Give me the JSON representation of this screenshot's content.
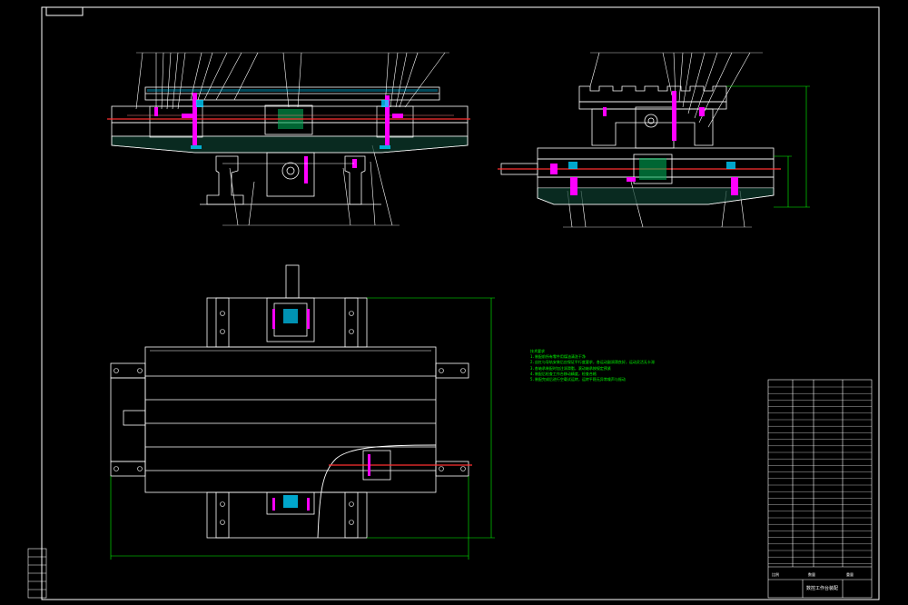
{
  "title_block": {
    "drawing_title": "数控工作台装配",
    "sheet_marks": [
      "比例",
      "数量",
      "重量"
    ]
  },
  "notes": [
    "技术要求",
    "1.装配前所有零件用煤油清洗干净",
    "2.丝杠与导轨安装后应保证平行度要求，各运动副润滑良好，运动灵活无卡滞",
    "3.各轴承装配时加注润滑脂，滚动轴承按规定预紧",
    "4.装配后检查工作台移动精度，检查合格",
    "5.装配完成后进行空载试运转，运转平稳无异常噪声与振动"
  ],
  "colors": {
    "outline": "#ffffff",
    "hidden_part": "#ff00ff",
    "centerline": "#ff3030",
    "dimension": "#00ff00",
    "section_fill": "#00d0ff"
  }
}
